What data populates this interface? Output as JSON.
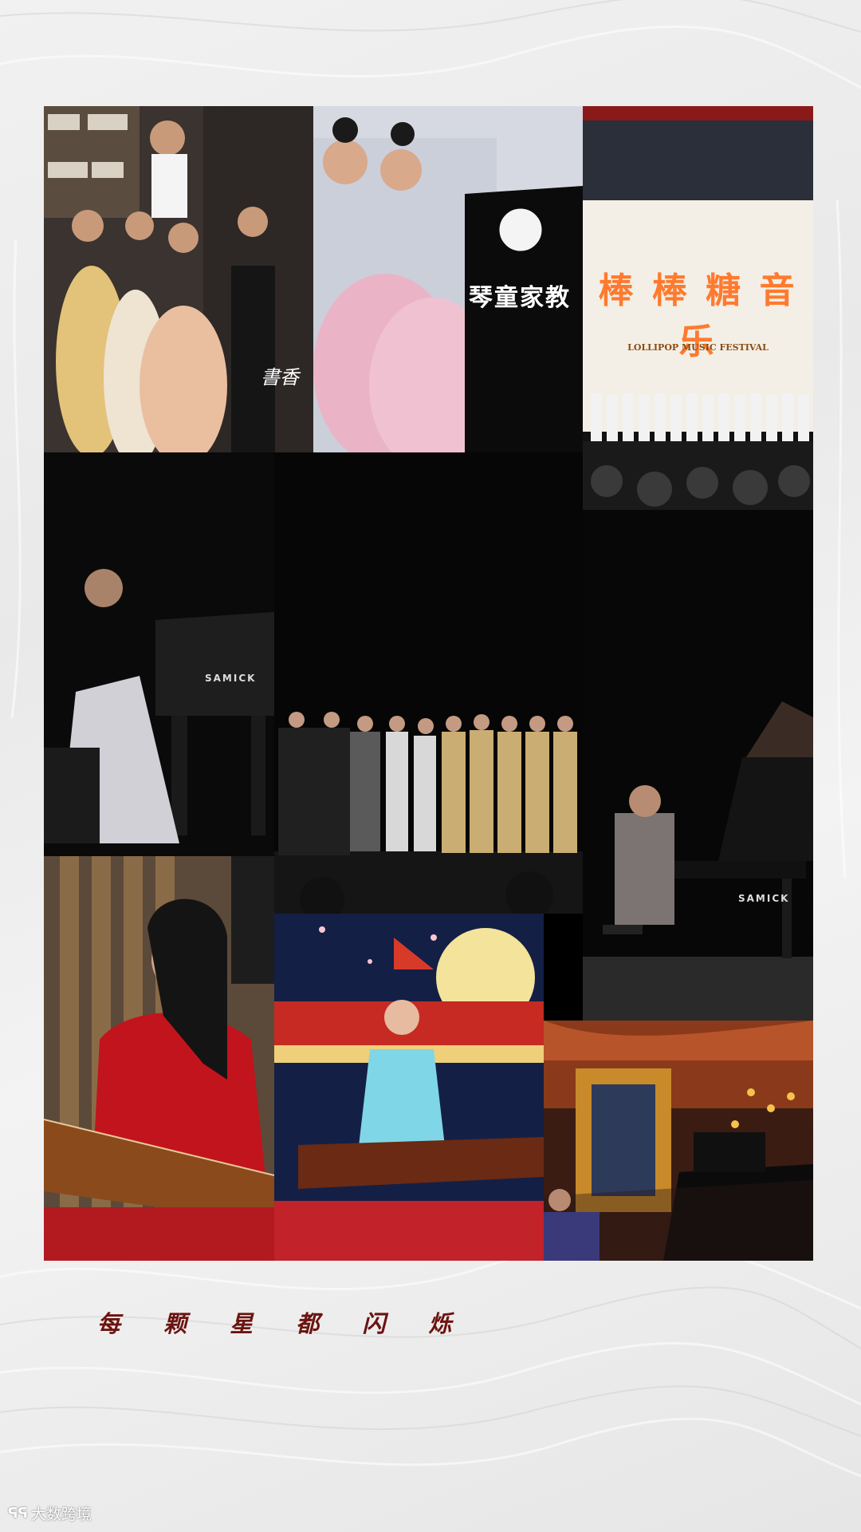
{
  "caption": "每 颗 星 都 闪 烁",
  "watermark": {
    "logo": "ᕋᕋ",
    "text": "大数跨境"
  },
  "photos": [
    {
      "name": "photo-children-formal-group",
      "signature": "書香"
    },
    {
      "name": "photo-girls-duet-piano",
      "logo_text": "琴童家教"
    },
    {
      "name": "photo-lollipop-festival",
      "festival_title": "棒 棒 糖 音 乐",
      "festival_sub": "LOLLIPOP MUSIC FESTIVAL"
    },
    {
      "name": "photo-girl-samick-piano",
      "brand": "SAMICK"
    },
    {
      "name": "photo-choir-stage"
    },
    {
      "name": "photo-man-samick-piano",
      "brand": "SAMICK"
    },
    {
      "name": "photo-girl-guzheng-red"
    },
    {
      "name": "photo-girl-guzheng-moon"
    },
    {
      "name": "photo-girl-grand-piano-palace"
    }
  ]
}
